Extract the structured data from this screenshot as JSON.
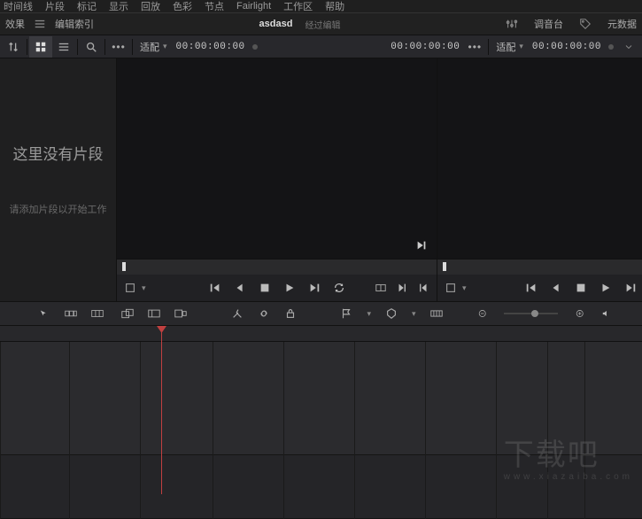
{
  "menu": [
    "时间线",
    "片段",
    "标记",
    "显示",
    "回放",
    "色彩",
    "节点",
    "Fairlight",
    "工作区",
    "帮助"
  ],
  "titlebar": {
    "left": {
      "fx": "效果",
      "idx": "编辑索引"
    },
    "project": "asdasd",
    "past": "经过编辑",
    "right": {
      "mixer": "调音台",
      "meta": "元数据"
    }
  },
  "toolbar": {
    "fit_left": "适配",
    "tc_left": "00:00:00:00",
    "tc_right": "00:00:00:00",
    "fit_right": "适配",
    "tc_far": "00:00:00:00"
  },
  "bin": {
    "msg1": "这里没有片段",
    "msg2": "请添加片段以开始工作"
  },
  "watermark": {
    "main": "下载吧",
    "sub": "www.xiazaiba.com"
  }
}
